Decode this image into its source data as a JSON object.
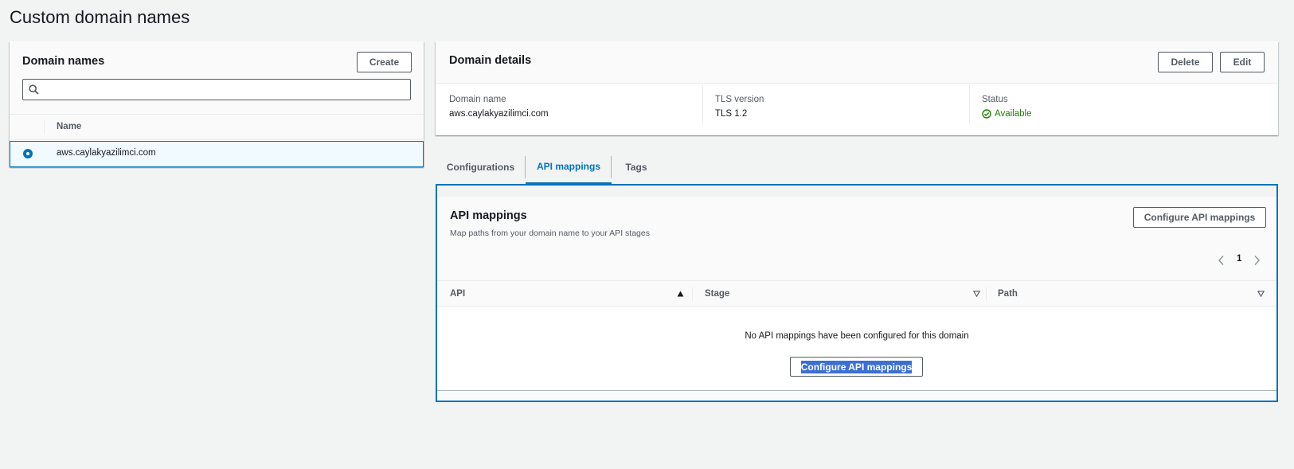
{
  "page": {
    "title": "Custom domain names"
  },
  "domain_list": {
    "title": "Domain names",
    "create_label": "Create",
    "search_value": "",
    "search_placeholder": "",
    "column_name": "Name",
    "rows": [
      {
        "name": "aws.caylakyazilimci.com",
        "selected": true
      }
    ]
  },
  "details": {
    "title": "Domain details",
    "delete_label": "Delete",
    "edit_label": "Edit",
    "fields": [
      {
        "label": "Domain name",
        "value": "aws.caylakyazilimci.com"
      },
      {
        "label": "TLS version",
        "value": "TLS 1.2"
      },
      {
        "label": "Status",
        "value": "Available"
      }
    ]
  },
  "tabs": [
    {
      "label": "Configurations",
      "active": false
    },
    {
      "label": "API mappings",
      "active": true
    },
    {
      "label": "Tags",
      "active": false
    }
  ],
  "api_mappings": {
    "title": "API mappings",
    "description": "Map paths from your domain name to your API stages",
    "configure_label": "Configure API mappings",
    "page_number": "1",
    "columns": [
      "API",
      "Stage",
      "Path"
    ],
    "empty_message": "No API mappings have been configured for this domain",
    "empty_configure_label": "Configure API mappings"
  },
  "colors": {
    "accent": "#0073bb",
    "success": "#1d8102",
    "background": "#f2f3f3"
  },
  "icons": [
    "search-icon",
    "check-circle-icon",
    "chevron-left-icon",
    "chevron-right-icon",
    "sort-ascending-icon",
    "sort-descending-icon"
  ]
}
